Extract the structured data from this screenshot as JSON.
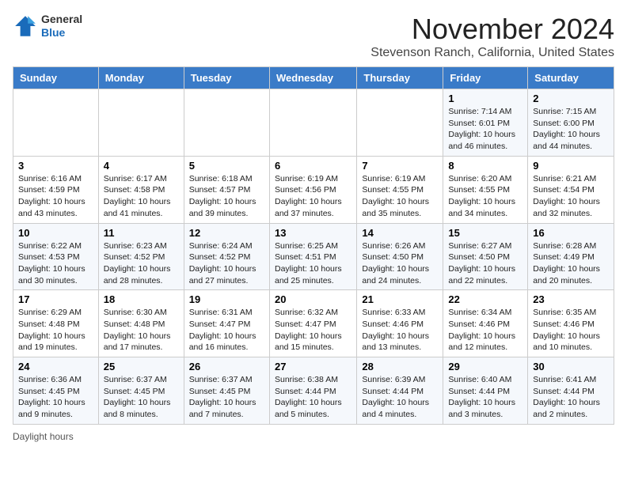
{
  "header": {
    "logo_general": "General",
    "logo_blue": "Blue",
    "month_title": "November 2024",
    "location": "Stevenson Ranch, California, United States"
  },
  "days_of_week": [
    "Sunday",
    "Monday",
    "Tuesday",
    "Wednesday",
    "Thursday",
    "Friday",
    "Saturday"
  ],
  "weeks": [
    [
      {
        "day": "",
        "info": ""
      },
      {
        "day": "",
        "info": ""
      },
      {
        "day": "",
        "info": ""
      },
      {
        "day": "",
        "info": ""
      },
      {
        "day": "",
        "info": ""
      },
      {
        "day": "1",
        "info": "Sunrise: 7:14 AM\nSunset: 6:01 PM\nDaylight: 10 hours and 46 minutes."
      },
      {
        "day": "2",
        "info": "Sunrise: 7:15 AM\nSunset: 6:00 PM\nDaylight: 10 hours and 44 minutes."
      }
    ],
    [
      {
        "day": "3",
        "info": "Sunrise: 6:16 AM\nSunset: 4:59 PM\nDaylight: 10 hours and 43 minutes."
      },
      {
        "day": "4",
        "info": "Sunrise: 6:17 AM\nSunset: 4:58 PM\nDaylight: 10 hours and 41 minutes."
      },
      {
        "day": "5",
        "info": "Sunrise: 6:18 AM\nSunset: 4:57 PM\nDaylight: 10 hours and 39 minutes."
      },
      {
        "day": "6",
        "info": "Sunrise: 6:19 AM\nSunset: 4:56 PM\nDaylight: 10 hours and 37 minutes."
      },
      {
        "day": "7",
        "info": "Sunrise: 6:19 AM\nSunset: 4:55 PM\nDaylight: 10 hours and 35 minutes."
      },
      {
        "day": "8",
        "info": "Sunrise: 6:20 AM\nSunset: 4:55 PM\nDaylight: 10 hours and 34 minutes."
      },
      {
        "day": "9",
        "info": "Sunrise: 6:21 AM\nSunset: 4:54 PM\nDaylight: 10 hours and 32 minutes."
      }
    ],
    [
      {
        "day": "10",
        "info": "Sunrise: 6:22 AM\nSunset: 4:53 PM\nDaylight: 10 hours and 30 minutes."
      },
      {
        "day": "11",
        "info": "Sunrise: 6:23 AM\nSunset: 4:52 PM\nDaylight: 10 hours and 28 minutes."
      },
      {
        "day": "12",
        "info": "Sunrise: 6:24 AM\nSunset: 4:52 PM\nDaylight: 10 hours and 27 minutes."
      },
      {
        "day": "13",
        "info": "Sunrise: 6:25 AM\nSunset: 4:51 PM\nDaylight: 10 hours and 25 minutes."
      },
      {
        "day": "14",
        "info": "Sunrise: 6:26 AM\nSunset: 4:50 PM\nDaylight: 10 hours and 24 minutes."
      },
      {
        "day": "15",
        "info": "Sunrise: 6:27 AM\nSunset: 4:50 PM\nDaylight: 10 hours and 22 minutes."
      },
      {
        "day": "16",
        "info": "Sunrise: 6:28 AM\nSunset: 4:49 PM\nDaylight: 10 hours and 20 minutes."
      }
    ],
    [
      {
        "day": "17",
        "info": "Sunrise: 6:29 AM\nSunset: 4:48 PM\nDaylight: 10 hours and 19 minutes."
      },
      {
        "day": "18",
        "info": "Sunrise: 6:30 AM\nSunset: 4:48 PM\nDaylight: 10 hours and 17 minutes."
      },
      {
        "day": "19",
        "info": "Sunrise: 6:31 AM\nSunset: 4:47 PM\nDaylight: 10 hours and 16 minutes."
      },
      {
        "day": "20",
        "info": "Sunrise: 6:32 AM\nSunset: 4:47 PM\nDaylight: 10 hours and 15 minutes."
      },
      {
        "day": "21",
        "info": "Sunrise: 6:33 AM\nSunset: 4:46 PM\nDaylight: 10 hours and 13 minutes."
      },
      {
        "day": "22",
        "info": "Sunrise: 6:34 AM\nSunset: 4:46 PM\nDaylight: 10 hours and 12 minutes."
      },
      {
        "day": "23",
        "info": "Sunrise: 6:35 AM\nSunset: 4:46 PM\nDaylight: 10 hours and 10 minutes."
      }
    ],
    [
      {
        "day": "24",
        "info": "Sunrise: 6:36 AM\nSunset: 4:45 PM\nDaylight: 10 hours and 9 minutes."
      },
      {
        "day": "25",
        "info": "Sunrise: 6:37 AM\nSunset: 4:45 PM\nDaylight: 10 hours and 8 minutes."
      },
      {
        "day": "26",
        "info": "Sunrise: 6:37 AM\nSunset: 4:45 PM\nDaylight: 10 hours and 7 minutes."
      },
      {
        "day": "27",
        "info": "Sunrise: 6:38 AM\nSunset: 4:44 PM\nDaylight: 10 hours and 5 minutes."
      },
      {
        "day": "28",
        "info": "Sunrise: 6:39 AM\nSunset: 4:44 PM\nDaylight: 10 hours and 4 minutes."
      },
      {
        "day": "29",
        "info": "Sunrise: 6:40 AM\nSunset: 4:44 PM\nDaylight: 10 hours and 3 minutes."
      },
      {
        "day": "30",
        "info": "Sunrise: 6:41 AM\nSunset: 4:44 PM\nDaylight: 10 hours and 2 minutes."
      }
    ]
  ],
  "footer": {
    "daylight_label": "Daylight hours"
  }
}
